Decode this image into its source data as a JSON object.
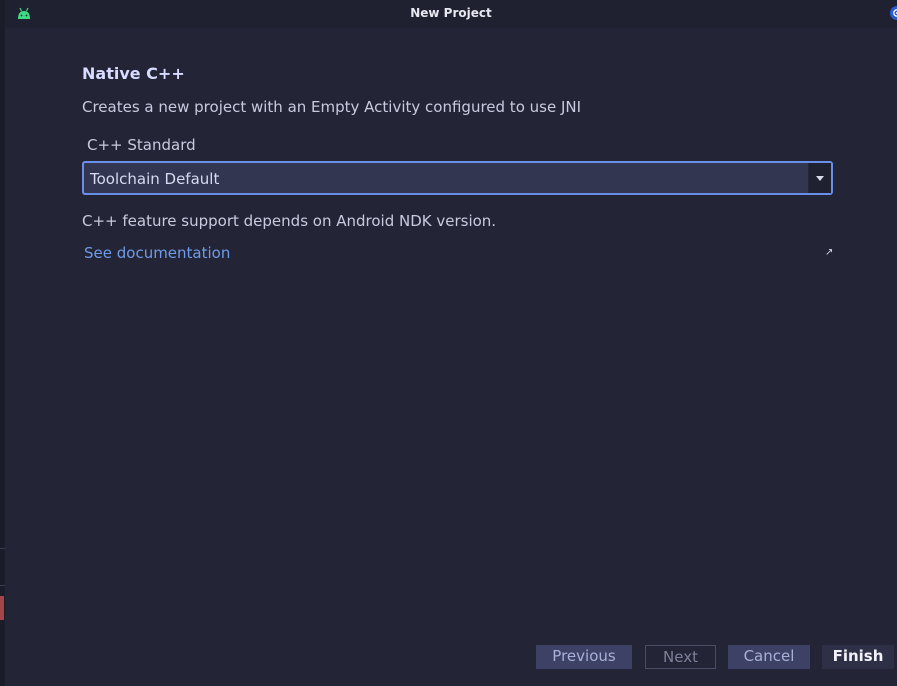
{
  "window": {
    "title": "New Project"
  },
  "icons": {
    "app": "android-icon",
    "corner": "settings-badge-icon",
    "dropdown": "chevron-down-icon",
    "external": "external-link-icon"
  },
  "colors": {
    "background": "#232436",
    "accent": "#6a8fe8",
    "link": "#6f9be8",
    "android_green": "#3ddc84"
  },
  "page": {
    "heading": "Native C++",
    "description": "Creates a new project with an Empty Activity configured to use JNI",
    "cpp_standard": {
      "label": "C++ Standard",
      "selected": "Toolchain Default"
    },
    "support_note": "C++ feature support depends on Android NDK version.",
    "doc_link": "See documentation"
  },
  "buttons": {
    "previous": "Previous",
    "next": "Next",
    "cancel": "Cancel",
    "finish": "Finish"
  }
}
